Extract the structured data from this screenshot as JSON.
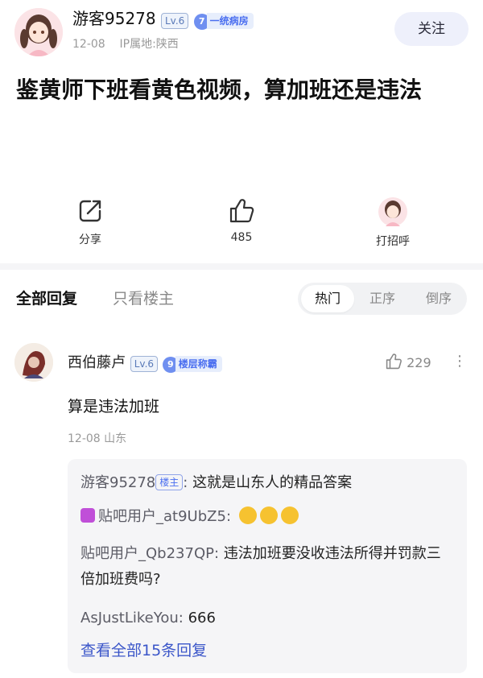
{
  "post": {
    "author": "游客95278",
    "level": "Lv.6",
    "badge_num": "7",
    "badge_text": "一统病房",
    "date": "12-08",
    "ip": "IP属地:陕西",
    "follow_label": "关注",
    "title": "鉴黄师下班看黄色视频，算加班还是违法"
  },
  "actions": [
    {
      "label": "分享",
      "icon": "share-icon"
    },
    {
      "label": "485",
      "icon": "thumbs-up-icon"
    },
    {
      "label": "打招呼",
      "icon": "avatar-icon"
    }
  ],
  "tabs": {
    "all": "全部回复",
    "op_only": "只看楼主",
    "sort": [
      "热门",
      "正序",
      "倒序"
    ]
  },
  "comment": {
    "author": "西伯藤卢",
    "level": "Lv.6",
    "badge_num": "9",
    "badge_text": "楼层称霸",
    "likes": "229",
    "text": "算是违法加班",
    "date": "12-08",
    "location": "山东"
  },
  "replies": [
    {
      "name": "游客95278",
      "host_tag": "楼主",
      "text": "这就是山东人的精品答案"
    },
    {
      "name": "贴吧用户_at9UbZ5",
      "text": ""
    },
    {
      "name": "贴吧用户_Qb237QP",
      "text": "违法加班要没收违法所得并罚款三倍加班费吗?"
    },
    {
      "name": "AsJustLikeYou",
      "text": "666"
    }
  ],
  "view_all": "查看全部15条回复"
}
